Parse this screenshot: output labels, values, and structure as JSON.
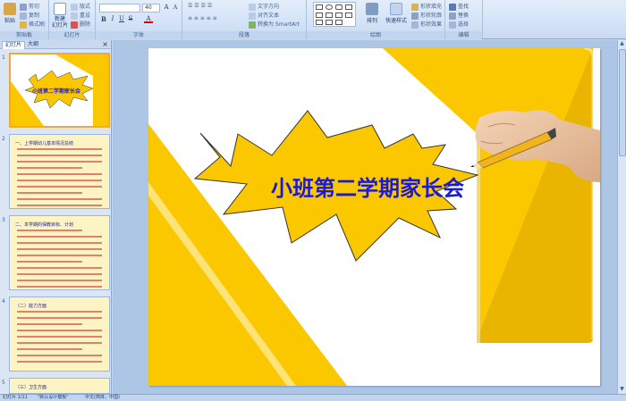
{
  "ribbon": {
    "clipboard": {
      "paste": "粘贴",
      "cut": "剪切",
      "copy": "复制",
      "format_painter": "格式刷",
      "label": "剪贴板"
    },
    "slides": {
      "new_slide": "新建\n幻灯片",
      "layout": "版式",
      "reset": "重设",
      "delete": "删除",
      "label": "幻灯片"
    },
    "font": {
      "font_name": "",
      "font_size": "40",
      "label": "字体"
    },
    "paragraph": {
      "text_direction": "文字方向",
      "align_text": "对齐文本",
      "smartart": "转换为 SmartArt",
      "label": "段落"
    },
    "drawing": {
      "arrange": "排列",
      "quick_styles": "快速样式",
      "shape_fill": "形状填充",
      "shape_outline": "形状轮廓",
      "shape_effects": "形状效果",
      "label": "绘图"
    },
    "editing": {
      "find": "查找",
      "replace": "替换",
      "select": "选择",
      "label": "编辑"
    }
  },
  "panel": {
    "tabs": [
      "幻灯片",
      "大纲"
    ],
    "thumbs": [
      {
        "num": "1",
        "title": "小班第二学期家长会"
      },
      {
        "num": "2",
        "heading": "一、上学期幼儿基本情况总结"
      },
      {
        "num": "3",
        "heading": "二、本学期的保教目标、计划"
      },
      {
        "num": "4",
        "heading": "（二）能力方面"
      },
      {
        "num": "5",
        "heading": "（三）卫生方面"
      }
    ]
  },
  "slide": {
    "title": "小班第二学期家长会"
  },
  "status": {
    "slide_count": "幻灯片 1/11",
    "theme": "\"默认设计模板\"",
    "language": "中文(简体，中国)"
  },
  "colors": {
    "accent_yellow": "#fbc800",
    "title_blue": "#1a1ad6"
  }
}
